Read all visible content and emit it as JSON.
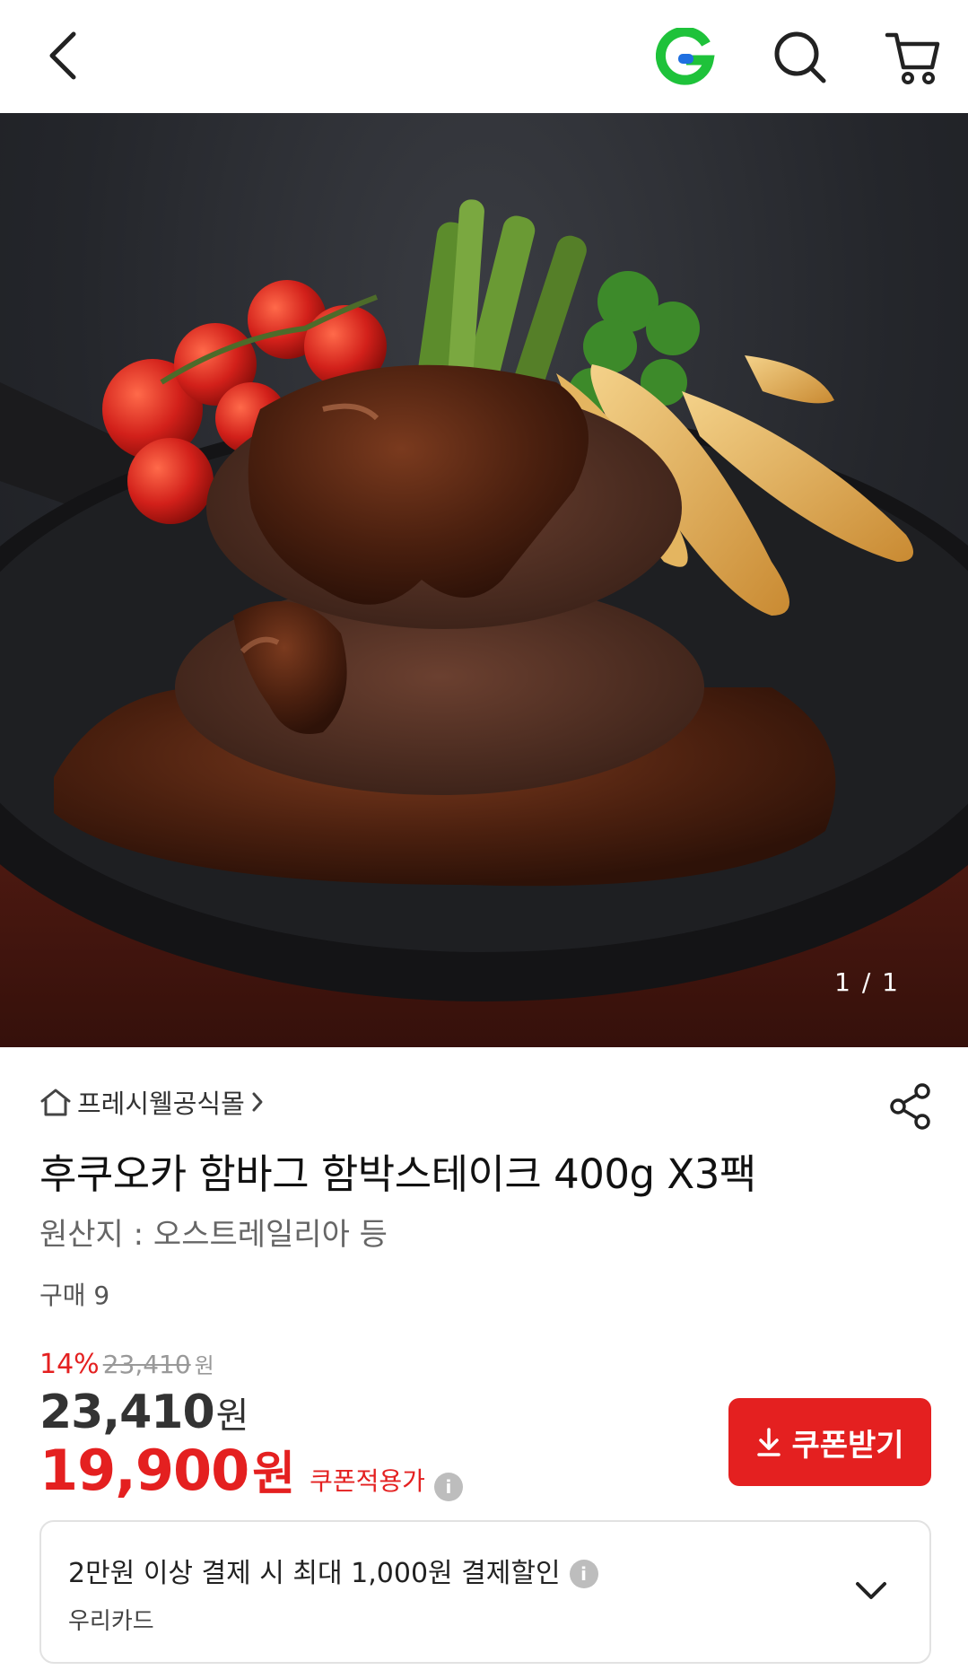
{
  "header": {
    "back_icon": "chevron-left-icon",
    "logo_letter": "G",
    "logo_color": "#1ec23a",
    "logo_dot_color": "#1f6fe0",
    "search_icon": "search-icon",
    "cart_icon": "cart-icon"
  },
  "hero": {
    "image_counter": "1 / 1"
  },
  "product": {
    "store_name": "프레시웰공식몰",
    "title": "후쿠오카 함바그 함박스테이크 400g X3팩",
    "origin": "원산지 : 오스트레일리아 등",
    "purchase_count": "구매 9",
    "discount_rate": "14%",
    "original_price": "23,410",
    "original_price_unit": "원",
    "price": "23,410",
    "price_unit": "원",
    "coupon_price": "19,900",
    "coupon_price_unit": "원",
    "coupon_price_label": "쿠폰적용가",
    "coupon_button_label": "쿠폰받기"
  },
  "card_promo": {
    "title": "2만원 이상 결제 시 최대 1,000원 결제할인",
    "card_name": "우리카드"
  },
  "colors": {
    "accent_red": "#e42020",
    "logo_green": "#1ec23a"
  }
}
